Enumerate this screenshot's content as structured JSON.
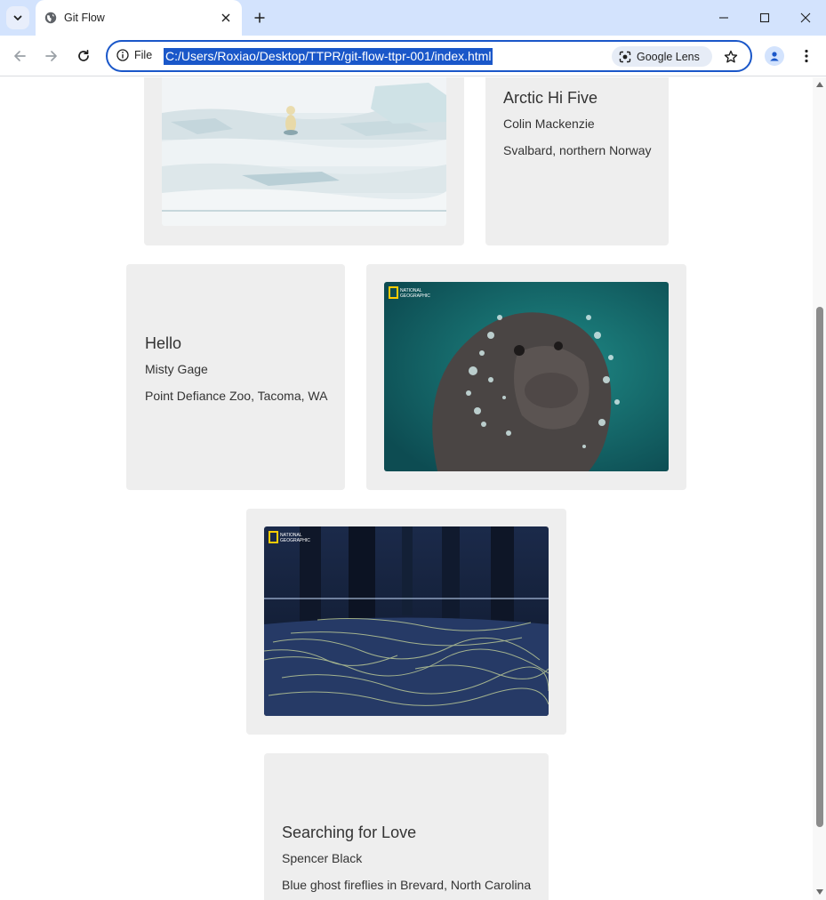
{
  "browser": {
    "tab_title": "Git Flow",
    "site_info_label": "File",
    "url": "C:/Users/Roxiao/Desktop/TTPR/git-flow-ttpr-001/index.html",
    "lens_label": "Google Lens"
  },
  "cards": [
    {
      "title": "Arctic Hi Five",
      "photographer": "Colin Mackenzie",
      "location": "Svalbard, northern Norway"
    },
    {
      "title": "Hello",
      "photographer": "Misty Gage",
      "location": "Point Defiance Zoo, Tacoma, WA"
    },
    {
      "title": "Searching for Love",
      "photographer": "Spencer Black",
      "location": "Blue ghost fireflies in Brevard, North Carolina"
    }
  ],
  "photos": {
    "walrus_logo": "NATIONAL GEOGRAPHIC",
    "fireflies_logo": "NATIONAL GEOGRAPHIC"
  }
}
